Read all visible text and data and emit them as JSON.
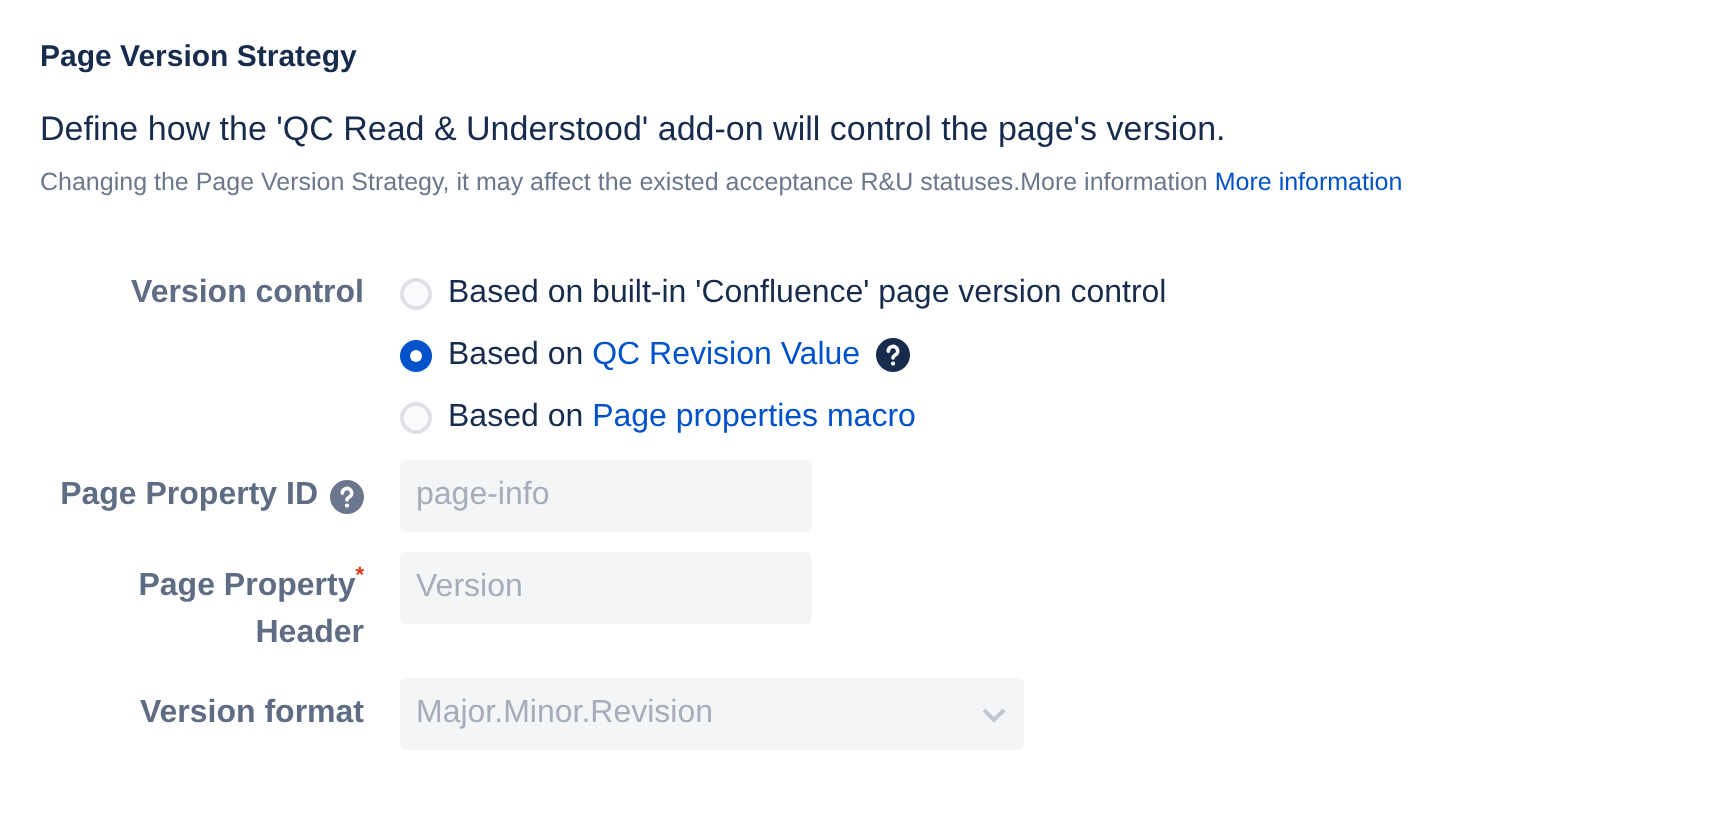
{
  "title": "Page Version Strategy",
  "description": "Define how the 'QC Read & Understood' add-on will control the page's version.",
  "note": {
    "text": "Changing the Page Version Strategy, it may affect the existed acceptance R&U statuses.More information",
    "link": "More information"
  },
  "version_control": {
    "label": "Version control",
    "options": [
      {
        "text": "Based on built-in 'Confluence' page version control",
        "selected": false,
        "help": false
      },
      {
        "text": "Based on",
        "link": "QC Revision Value",
        "selected": true,
        "help": true
      },
      {
        "text": "Based on",
        "link": "Page properties macro",
        "selected": false,
        "help": false
      }
    ]
  },
  "fields": [
    {
      "kind": "input",
      "label": "Page Property ID",
      "help": true,
      "value": "page-info",
      "disabled": true
    },
    {
      "kind": "input",
      "label": "Page Property$^{*}$ Header",
      "help": false,
      "value": "Version",
      "disabled": true
    },
    {
      "kind": "select",
      "label": "Version format",
      "help": false,
      "value": "Major.Minor.Revision",
      "disabled": true
    }
  ]
}
